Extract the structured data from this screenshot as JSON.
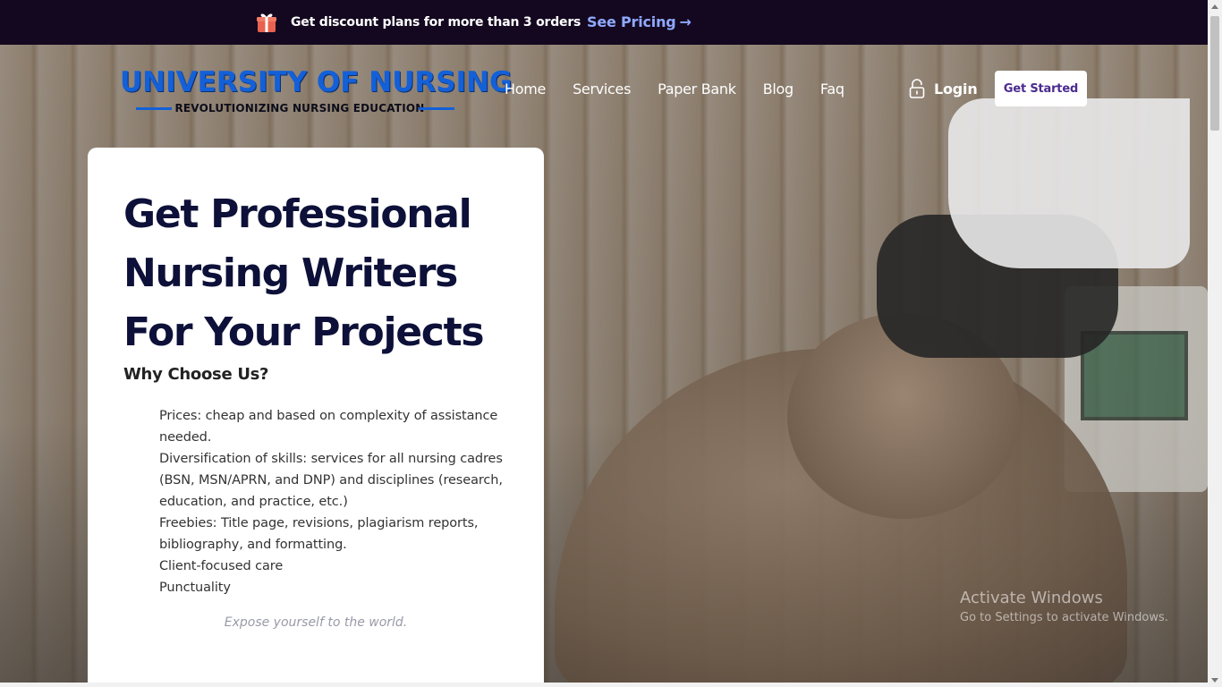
{
  "promo": {
    "text": "Get discount plans for more than 3 orders",
    "link_label": "See Pricing",
    "arrow": "→",
    "link_color": "#8fa9ff"
  },
  "header": {
    "logo_title": "UNIVERSITY OF NURSING",
    "logo_tagline": "REVOLUTIONIZING NURSING EDUCATION",
    "nav": [
      "Home",
      "Services",
      "Paper Bank",
      "Blog",
      "Faq"
    ],
    "login_label": "Login",
    "cta_label": "Get Started"
  },
  "hero": {
    "title": "Get Professional Nursing Writers For Your Projects",
    "subheading": "Why Choose Us?",
    "reasons": [
      "Prices: cheap and based on complexity of assistance needed.",
      "Diversification of skills: services for all nursing cadres (BSN, MSN/APRN, and DNP) and disciplines (research, education, and practice, etc.)",
      "Freebies: Title page, revisions, plagiarism reports, bibliography, and formatting.",
      "Client-focused care",
      "Punctuality"
    ],
    "footer_note": "Expose yourself to the world."
  },
  "watermark": {
    "title": "Activate Windows",
    "subtitle": "Go to Settings to activate Windows."
  },
  "colors": {
    "promo_bar": "#140820",
    "logo_blue": "#1360d8",
    "title_navy": "#0d1038",
    "cta_text": "#4a2a8f"
  }
}
